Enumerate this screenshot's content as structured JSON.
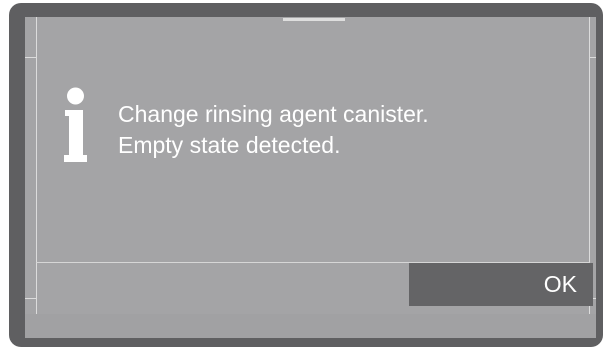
{
  "dialog": {
    "icon": "info-icon",
    "message_lines": [
      "Change rinsing agent canister.",
      "Empty state detected."
    ],
    "ok_label": "OK"
  },
  "colors": {
    "frame": "#5f5f61",
    "screen": "#a4a4a6",
    "button": "#646466",
    "text": "#ffffff"
  }
}
